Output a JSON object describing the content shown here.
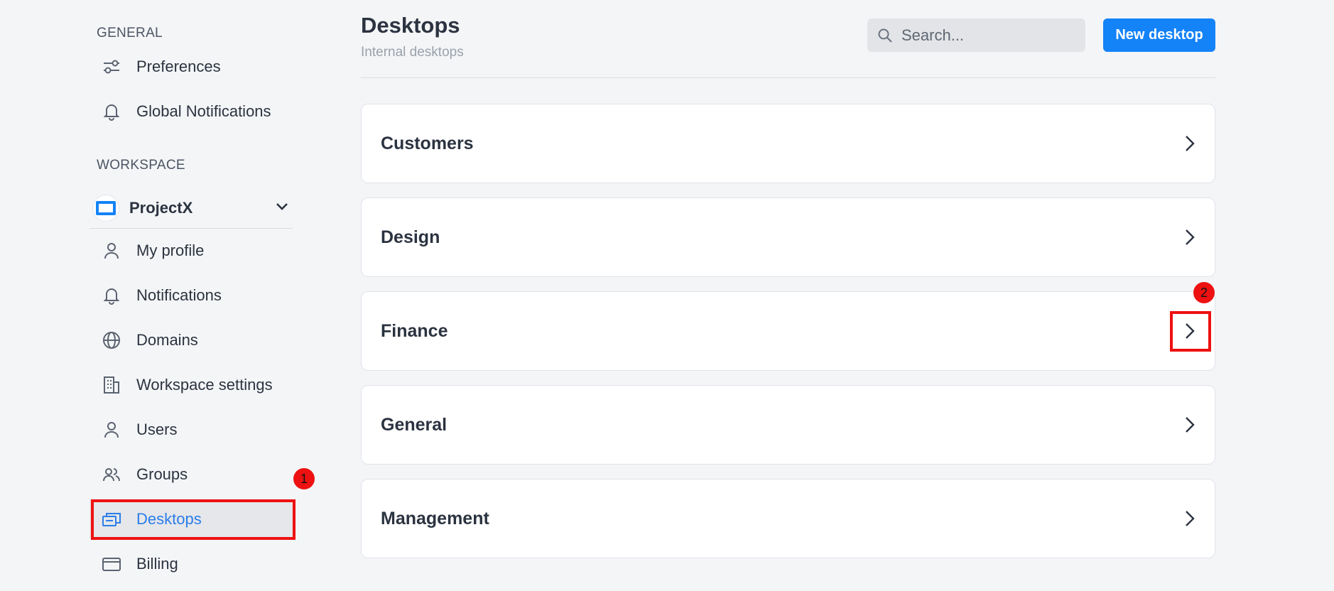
{
  "sidebar": {
    "general_title": "GENERAL",
    "general_items": [
      {
        "label": "Preferences",
        "icon": "sliders-icon"
      },
      {
        "label": "Global Notifications",
        "icon": "bell-icon"
      }
    ],
    "workspace_title": "WORKSPACE",
    "workspace": {
      "name": "ProjectX",
      "logo": "workspace-logo-icon"
    },
    "workspace_items": [
      {
        "label": "My profile",
        "icon": "user-icon"
      },
      {
        "label": "Notifications",
        "icon": "bell-icon"
      },
      {
        "label": "Domains",
        "icon": "globe-icon"
      },
      {
        "label": "Workspace settings",
        "icon": "building-icon"
      },
      {
        "label": "Users",
        "icon": "user-icon"
      },
      {
        "label": "Groups",
        "icon": "users-icon"
      },
      {
        "label": "Desktops",
        "icon": "desktops-icon",
        "active": true
      },
      {
        "label": "Billing",
        "icon": "credit-card-icon"
      }
    ]
  },
  "header": {
    "title": "Desktops",
    "subtitle": "Internal desktops",
    "search_placeholder": "Search...",
    "new_button": "New desktop"
  },
  "desktops": [
    {
      "label": "Customers"
    },
    {
      "label": "Design"
    },
    {
      "label": "Finance"
    },
    {
      "label": "General"
    },
    {
      "label": "Management"
    }
  ],
  "annotations": [
    {
      "number": "1",
      "target": "Desktops sidebar item"
    },
    {
      "number": "2",
      "target": "Finance chevron"
    }
  ],
  "colors": {
    "accent": "#1483f7",
    "active_text": "#2b7de9",
    "annotation": "#ee1111",
    "background": "#f4f5f7"
  }
}
